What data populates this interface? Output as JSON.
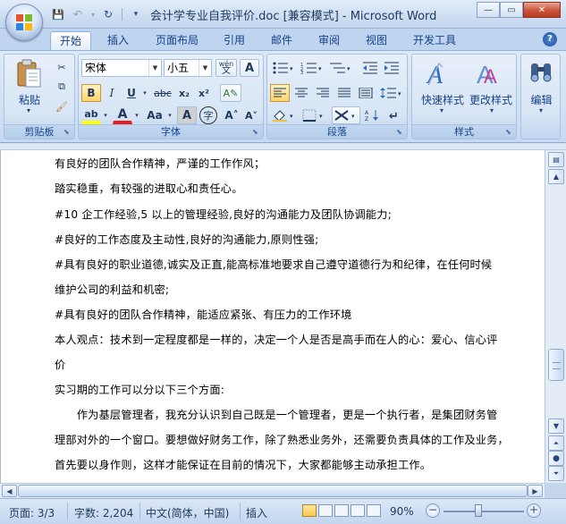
{
  "window": {
    "title": "会计学专业自我评价.doc [兼容模式] - Microsoft Word",
    "buttons": {
      "minimize": "—",
      "maximize": "▭",
      "close": "✕"
    }
  },
  "qat": {
    "save": "💾",
    "undo": "↶",
    "redo": "↻",
    "more": "▾"
  },
  "tabs": [
    "开始",
    "插入",
    "页面布局",
    "引用",
    "邮件",
    "审阅",
    "视图",
    "开发工具"
  ],
  "help": "?",
  "ribbon": {
    "clipboard": {
      "label": "剪贴板",
      "paste": "粘贴"
    },
    "font": {
      "label": "字体",
      "name": "宋体",
      "size": "小五",
      "wen": "wén",
      "bold": "B",
      "italic": "I",
      "underline": "U",
      "strike": "abc",
      "sub": "x₂",
      "sup": "x²",
      "aa": "Aa",
      "a_box": "A",
      "circle": "字",
      "grow": "A˄",
      "shrink": "A˅",
      "color": "A",
      "highlight": "ab"
    },
    "paragraph": {
      "label": "段落"
    },
    "styles": {
      "label": "样式",
      "quick": "快速样式",
      "change": "更改样式"
    },
    "editing": {
      "label": "编辑"
    }
  },
  "document": {
    "lines": [
      "有良好的团队合作精神，严谨的工作作风；",
      "踏实稳重，有较强的进取心和责任心。",
      "#10 企工作经验,5 以上的管理经验,良好的沟通能力及团队协调能力;",
      "#良好的工作态度及主动性,良好的沟通能力,原则性强;",
      "#具有良好的职业道德,诚实及正直,能高标准地要求自己遵守道德行为和纪律，在任何时候",
      "维护公司的利益和机密;",
      "#具有良好的团队合作精神，能适应紧张、有压力的工作环境",
      "本人观点：技术到一定程度都是一样的，决定一个人是否是高手而在人的心：爱心、信心评",
      "价",
      "实习期的工作可以分以下三个方面:",
      "　　作为基层管理者，我充分认识到自己既是一个管理者，更是一个执行者，是集团财务管",
      "理部对外的一个窗口。要想做好财务工作，除了熟悉业务外，还需要负责具体的工作及业务，",
      "首先要以身作则，这样才能保证在目前的情况下，大家都能够主动承担工作。"
    ]
  },
  "status": {
    "page": "页面: 3/3",
    "words": "字数: 2,204",
    "language": "中文(简体，中国)",
    "insert": "插入",
    "zoom": "90%",
    "zoom_minus": "−",
    "zoom_plus": "+",
    "zoom_level": 0.9
  }
}
